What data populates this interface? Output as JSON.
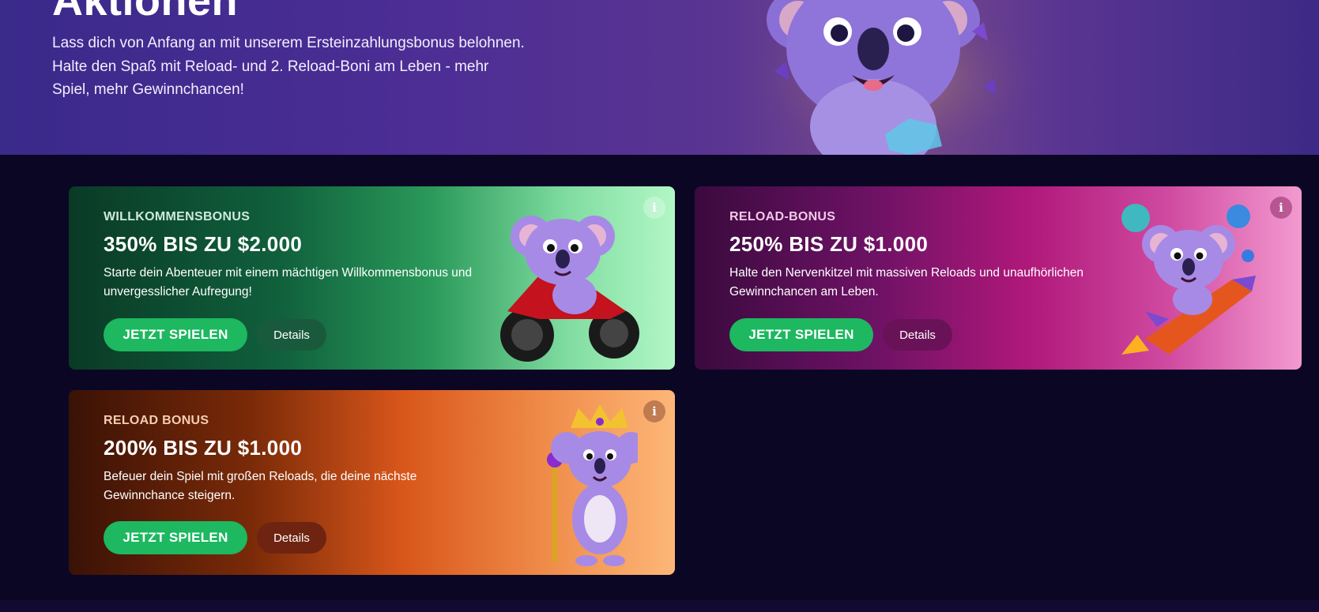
{
  "hero": {
    "title": "Aktionen",
    "description": "Lass dich von Anfang an mit unserem Ersteinzahlungsbonus belohnen. Halte den Spaß mit Reload- und 2. Reload-Boni am Leben - mehr Spiel, mehr Gewinnchancen!"
  },
  "promotions": [
    {
      "label": "WILLKOMMENSBONUS",
      "title": "350% BIS ZU $2.000",
      "description": "Starte dein Abenteuer mit einem mächtigen Willkommensbonus und unvergesslicher Aufregung!",
      "play_label": "JETZT SPIELEN",
      "details_label": "Details",
      "info_icon": "i",
      "art": "koala-motorcycle-illustration"
    },
    {
      "label": "RELOAD-BONUS",
      "title": "250% BIS ZU $1.000",
      "description": "Halte den Nervenkitzel mit massiven Reloads und unaufhörlichen Gewinnchancen am Leben.",
      "play_label": "JETZT SPIELEN",
      "details_label": "Details",
      "info_icon": "i",
      "art": "koala-rocket-illustration"
    },
    {
      "label": "RELOAD BONUS",
      "title": "200% BIS ZU $1.000",
      "description": "Befeuer dein Spiel mit großen Reloads, die deine nächste Gewinnchance steigern.",
      "play_label": "JETZT SPIELEN",
      "details_label": "Details",
      "info_icon": "i",
      "art": "koala-king-illustration"
    }
  ],
  "colors": {
    "play_button": "#1db860",
    "page_background": "#0b0624",
    "hero_background": "#4b2d94"
  }
}
